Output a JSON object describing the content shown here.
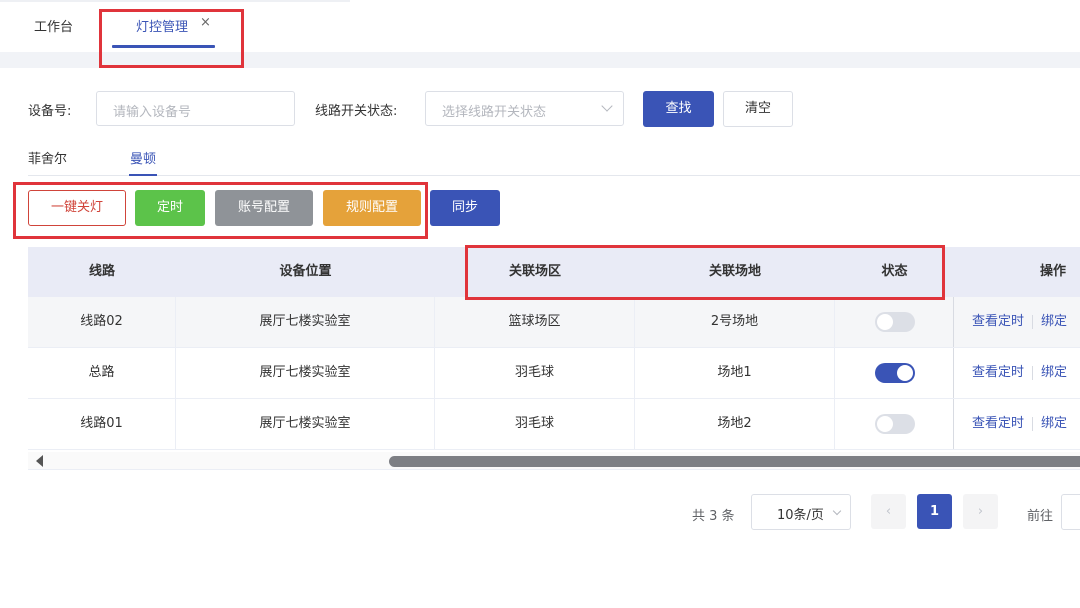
{
  "tabs": {
    "home_label": "工作台",
    "active_label": "灯控管理",
    "close_symbol": "×"
  },
  "search": {
    "device_label": "设备号:",
    "device_placeholder": "请输入设备号",
    "status_label": "线路开关状态:",
    "status_placeholder": "选择线路开关状态",
    "search_button": "查找",
    "clear_button": "清空"
  },
  "subtabs": [
    "菲舍尔",
    "曼顿"
  ],
  "actions": {
    "one_key_off": "一键关灯",
    "timer": "定时",
    "account_config": "账号配置",
    "rule_config": "规则配置",
    "sync": "同步"
  },
  "table": {
    "headers": [
      "线路",
      "设备位置",
      "关联场区",
      "关联场地",
      "状态",
      "操作"
    ],
    "rows": [
      {
        "line": "线路02",
        "location": "展厅七楼实验室",
        "area": "篮球场区",
        "venue": "2号场地",
        "on": false,
        "op1": "查看定时",
        "op2": "绑定"
      },
      {
        "line": "总路",
        "location": "展厅七楼实验室",
        "area": "羽毛球",
        "venue": "场地1",
        "on": true,
        "op1": "查看定时",
        "op2": "绑定"
      },
      {
        "line": "线路01",
        "location": "展厅七楼实验室",
        "area": "羽毛球",
        "venue": "场地2",
        "on": false,
        "op1": "查看定时",
        "op2": "绑定"
      }
    ]
  },
  "pagination": {
    "total": "共 3 条",
    "page_size": "10条/页",
    "prev": "‹",
    "current": "1",
    "next": "›",
    "goto": "前往"
  },
  "colors": {
    "primary": "#3a54b6",
    "danger": "#d0443a",
    "success": "#5cc34a",
    "gray": "#8f9398",
    "warning": "#e5a23a",
    "annotation": "#e0343b"
  }
}
